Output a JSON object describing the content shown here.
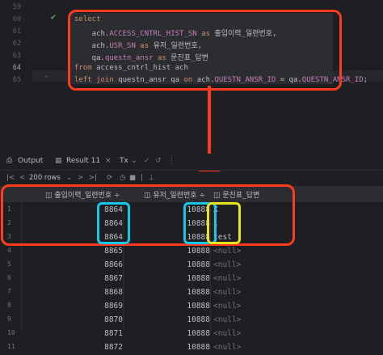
{
  "editor": {
    "line_numbers": [
      "59",
      "60",
      "61",
      "62",
      "63",
      "64",
      "65"
    ],
    "lines": [
      [
        {
          "t": "select",
          "c": "kw"
        }
      ],
      [
        {
          "t": "    ach.",
          "c": "plain"
        },
        {
          "t": "ACCESS_CNTRL_HIST_SN",
          "c": "field"
        },
        {
          "t": " as ",
          "c": "kw"
        },
        {
          "t": "출입이력_일련번호,",
          "c": "plain"
        }
      ],
      [
        {
          "t": "    ach.",
          "c": "plain"
        },
        {
          "t": "USR_SN",
          "c": "field"
        },
        {
          "t": " as ",
          "c": "kw"
        },
        {
          "t": "유저_일련번호,",
          "c": "plain"
        }
      ],
      [
        {
          "t": "    qa.",
          "c": "plain"
        },
        {
          "t": "questn_ansr",
          "c": "field"
        },
        {
          "t": " as ",
          "c": "kw"
        },
        {
          "t": "문진표_답변",
          "c": "plain"
        }
      ],
      [
        {
          "t": "from ",
          "c": "kw"
        },
        {
          "t": "access_cntrl_hist ach",
          "c": "plain"
        }
      ],
      [
        {
          "t": "left join ",
          "c": "kw"
        },
        {
          "t": "questn_ansr qa ",
          "c": "plain"
        },
        {
          "t": "on ",
          "c": "kw"
        },
        {
          "t": "ach.",
          "c": "plain"
        },
        {
          "t": "QUESTN_ANSR_ID",
          "c": "field"
        },
        {
          "t": " = qa.",
          "c": "plain"
        },
        {
          "t": "QUESTN_ANSR_ID",
          "c": "field"
        },
        {
          "t": ";",
          "c": "plain"
        }
      ]
    ]
  },
  "tabs": {
    "output_label": "Output",
    "result_label": "Result 11",
    "tx_label": "Tx"
  },
  "toolbar": {
    "rows_label": "200 rows"
  },
  "grid": {
    "columns": [
      "출입이력_일련번호 ÷",
      "유저_일련번호 ÷",
      "문진표_답변"
    ],
    "rows": [
      {
        "n": "1",
        "a": "8864",
        "b": "10888",
        "c": "X"
      },
      {
        "n": "2",
        "a": "8864",
        "b": "10888",
        "c": "1"
      },
      {
        "n": "3",
        "a": "8864",
        "b": "10888",
        "c": "test"
      },
      {
        "n": "4",
        "a": "8865",
        "b": "10888",
        "c": "<null>"
      },
      {
        "n": "5",
        "a": "8866",
        "b": "10888",
        "c": "<null>"
      },
      {
        "n": "6",
        "a": "8867",
        "b": "10888",
        "c": "<null>"
      },
      {
        "n": "7",
        "a": "8868",
        "b": "10888",
        "c": "<null>"
      },
      {
        "n": "8",
        "a": "8869",
        "b": "10888",
        "c": "<null>"
      },
      {
        "n": "9",
        "a": "8870",
        "b": "10888",
        "c": "<null>"
      },
      {
        "n": "10",
        "a": "8871",
        "b": "10888",
        "c": "<null>"
      },
      {
        "n": "11",
        "a": "8872",
        "b": "10888",
        "c": "<null>"
      }
    ]
  },
  "colors": {
    "annotation_red": "#ff3b1f",
    "annotation_cyan": "#17c6e8",
    "annotation_yellow": "#e9e51c"
  }
}
